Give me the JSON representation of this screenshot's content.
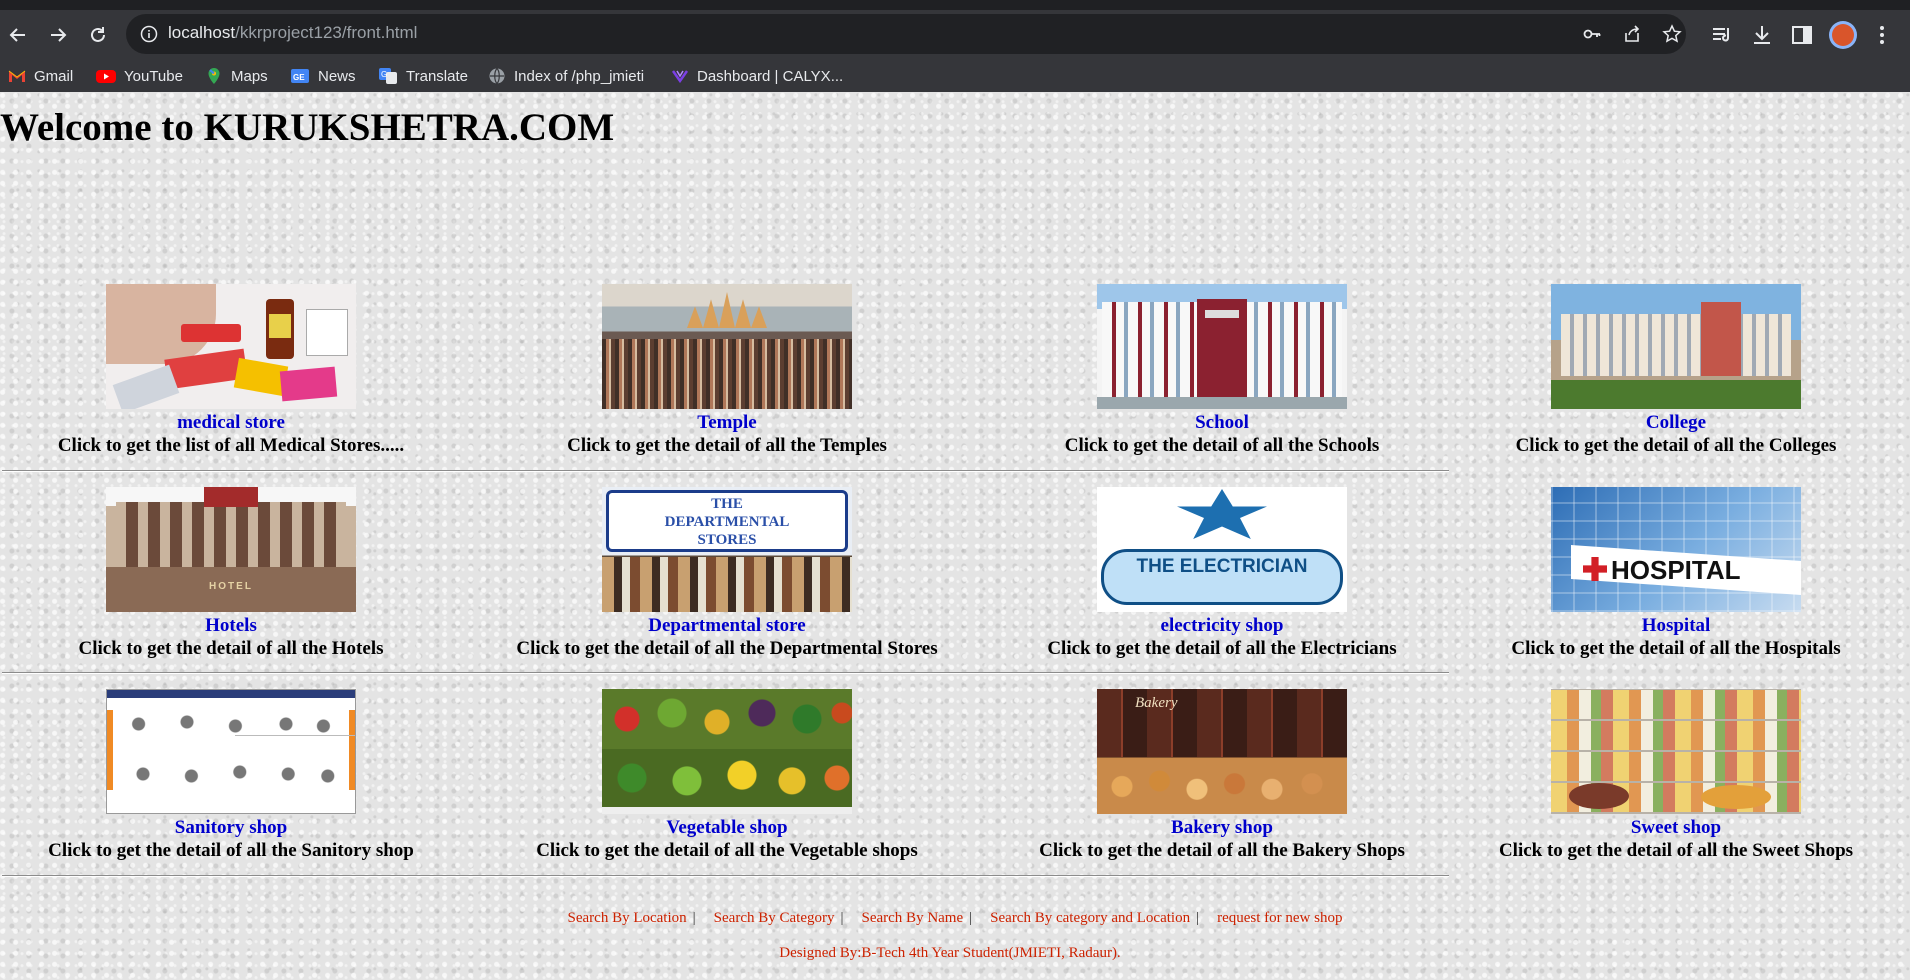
{
  "browser": {
    "url_host": "localhost",
    "url_path": "/kkrproject123/front.html",
    "bookmarks": [
      {
        "label": "Gmail",
        "icon": "gmail-icon"
      },
      {
        "label": "YouTube",
        "icon": "youtube-icon"
      },
      {
        "label": "Maps",
        "icon": "maps-icon"
      },
      {
        "label": "News",
        "icon": "news-icon"
      },
      {
        "label": "Translate",
        "icon": "translate-icon"
      },
      {
        "label": "Index of /php_jmieti",
        "icon": "globe-icon"
      },
      {
        "label": "Dashboard | CALYX...",
        "icon": "calyx-icon"
      }
    ]
  },
  "page": {
    "heading": "Welcome to KURUKSHETRA.COM",
    "categories": [
      {
        "link": "medical store",
        "desc": "Click to get the list of all Medical Stores....."
      },
      {
        "link": "Temple",
        "desc": "Click to get the detail of all the Temples"
      },
      {
        "link": "School",
        "desc": "Click to get the detail of all the Schools"
      },
      {
        "link": "College",
        "desc": "Click to get the detail of all the Colleges"
      },
      {
        "link": "Hotels",
        "desc": "Click to get the detail of all the Hotels"
      },
      {
        "link": "Departmental store",
        "desc": "Click to get the detail of all the Departmental Stores"
      },
      {
        "link": "electricity shop",
        "desc": "Click to get the detail of all the Electricians"
      },
      {
        "link": "Hospital",
        "desc": "Click to get the detail of all the Hospitals"
      },
      {
        "link": "Sanitory shop",
        "desc": "Click to get the detail of all the Sanitory shop"
      },
      {
        "link": "Vegetable shop",
        "desc": "Click to get the detail of all the Vegetable shops"
      },
      {
        "link": "Bakery shop",
        "desc": "Click to get the detail of all the Bakery Shops"
      },
      {
        "link": "Sweet shop",
        "desc": "Click to get the detail of all the Sweet Shops"
      }
    ],
    "image_text": {
      "departmental": "THE DEPARTMENTAL STORES",
      "electrician": "THE ELECTRICIAN",
      "hospital": "HOSPITAL",
      "hotel": "HOTEL",
      "bakery": "Bakery"
    },
    "footer_links": [
      "Search By Location",
      "Search By Category",
      "Search By Name",
      "Search By category and Location",
      "request for new shop"
    ],
    "separator": "|",
    "designed_by": "Designed By:B-Tech 4th Year Student(JMIETI, Radaur)."
  }
}
